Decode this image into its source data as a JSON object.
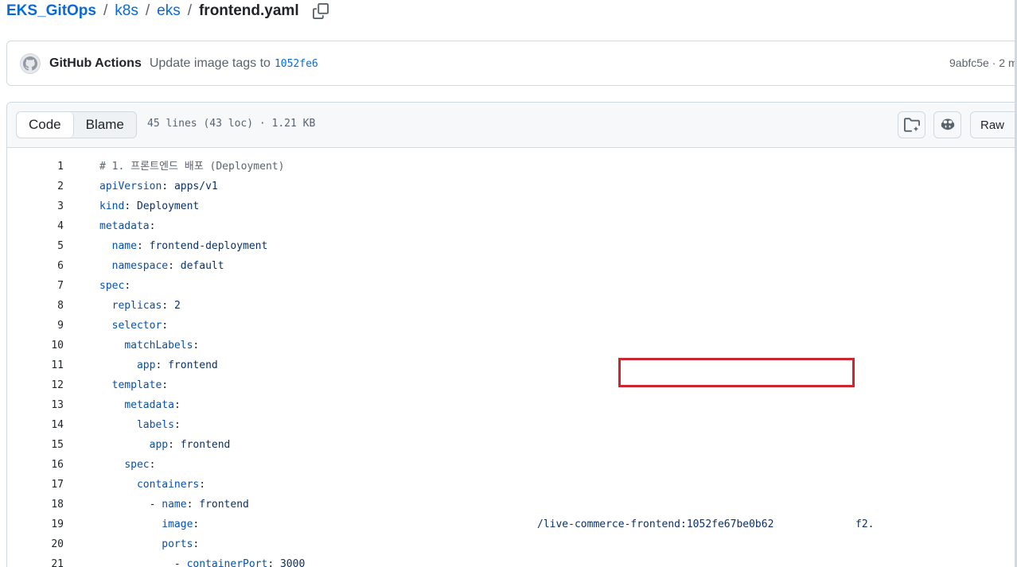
{
  "breadcrumb": {
    "repo": "EKS_GitOps",
    "folder1": "k8s",
    "folder2": "eks",
    "file": "frontend.yaml",
    "separator": "/"
  },
  "commit": {
    "author": "GitHub Actions",
    "message": "Update image tags to",
    "sha_link": "1052fe6",
    "right_text": "9abfc5e · 2 m"
  },
  "file_header": {
    "tabs": [
      "Code",
      "Blame"
    ],
    "active_tab": "Code",
    "info": "45 lines (43 loc) · 1.21 KB",
    "raw_label": "Raw"
  },
  "code_lines": [
    {
      "n": "1",
      "indent": "",
      "key": "",
      "value": "",
      "comment": "# 1. 프론트엔드 배포 (Deployment)"
    },
    {
      "n": "2",
      "indent": "",
      "key": "apiVersion",
      "value": "apps/v1"
    },
    {
      "n": "3",
      "indent": "",
      "key": "kind",
      "value": "Deployment"
    },
    {
      "n": "4",
      "indent": "",
      "key": "metadata",
      "value": ""
    },
    {
      "n": "5",
      "indent": "  ",
      "key": "name",
      "value": "frontend-deployment"
    },
    {
      "n": "6",
      "indent": "  ",
      "key": "namespace",
      "value": "default"
    },
    {
      "n": "7",
      "indent": "",
      "key": "spec",
      "value": ""
    },
    {
      "n": "8",
      "indent": "  ",
      "key": "replicas",
      "value": "2"
    },
    {
      "n": "9",
      "indent": "  ",
      "key": "selector",
      "value": ""
    },
    {
      "n": "10",
      "indent": "    ",
      "key": "matchLabels",
      "value": ""
    },
    {
      "n": "11",
      "indent": "      ",
      "key": "app",
      "value": "frontend"
    },
    {
      "n": "12",
      "indent": "  ",
      "key": "template",
      "value": ""
    },
    {
      "n": "13",
      "indent": "    ",
      "key": "metadata",
      "value": ""
    },
    {
      "n": "14",
      "indent": "      ",
      "key": "labels",
      "value": ""
    },
    {
      "n": "15",
      "indent": "        ",
      "key": "app",
      "value": "frontend"
    },
    {
      "n": "16",
      "indent": "    ",
      "key": "spec",
      "value": ""
    },
    {
      "n": "17",
      "indent": "      ",
      "key": "containers",
      "value": ""
    },
    {
      "n": "18",
      "indent": "        - ",
      "key": "name",
      "value": "frontend"
    },
    {
      "n": "19",
      "indent": "          ",
      "key": "image",
      "value": "",
      "image_tail": "/live-commerce-frontend:1052fe67be0b62",
      "image_end": "f2."
    },
    {
      "n": "20",
      "indent": "          ",
      "key": "ports",
      "value": ""
    },
    {
      "n": "21",
      "indent": "            - ",
      "key": "containerPort",
      "value": "3000"
    }
  ]
}
